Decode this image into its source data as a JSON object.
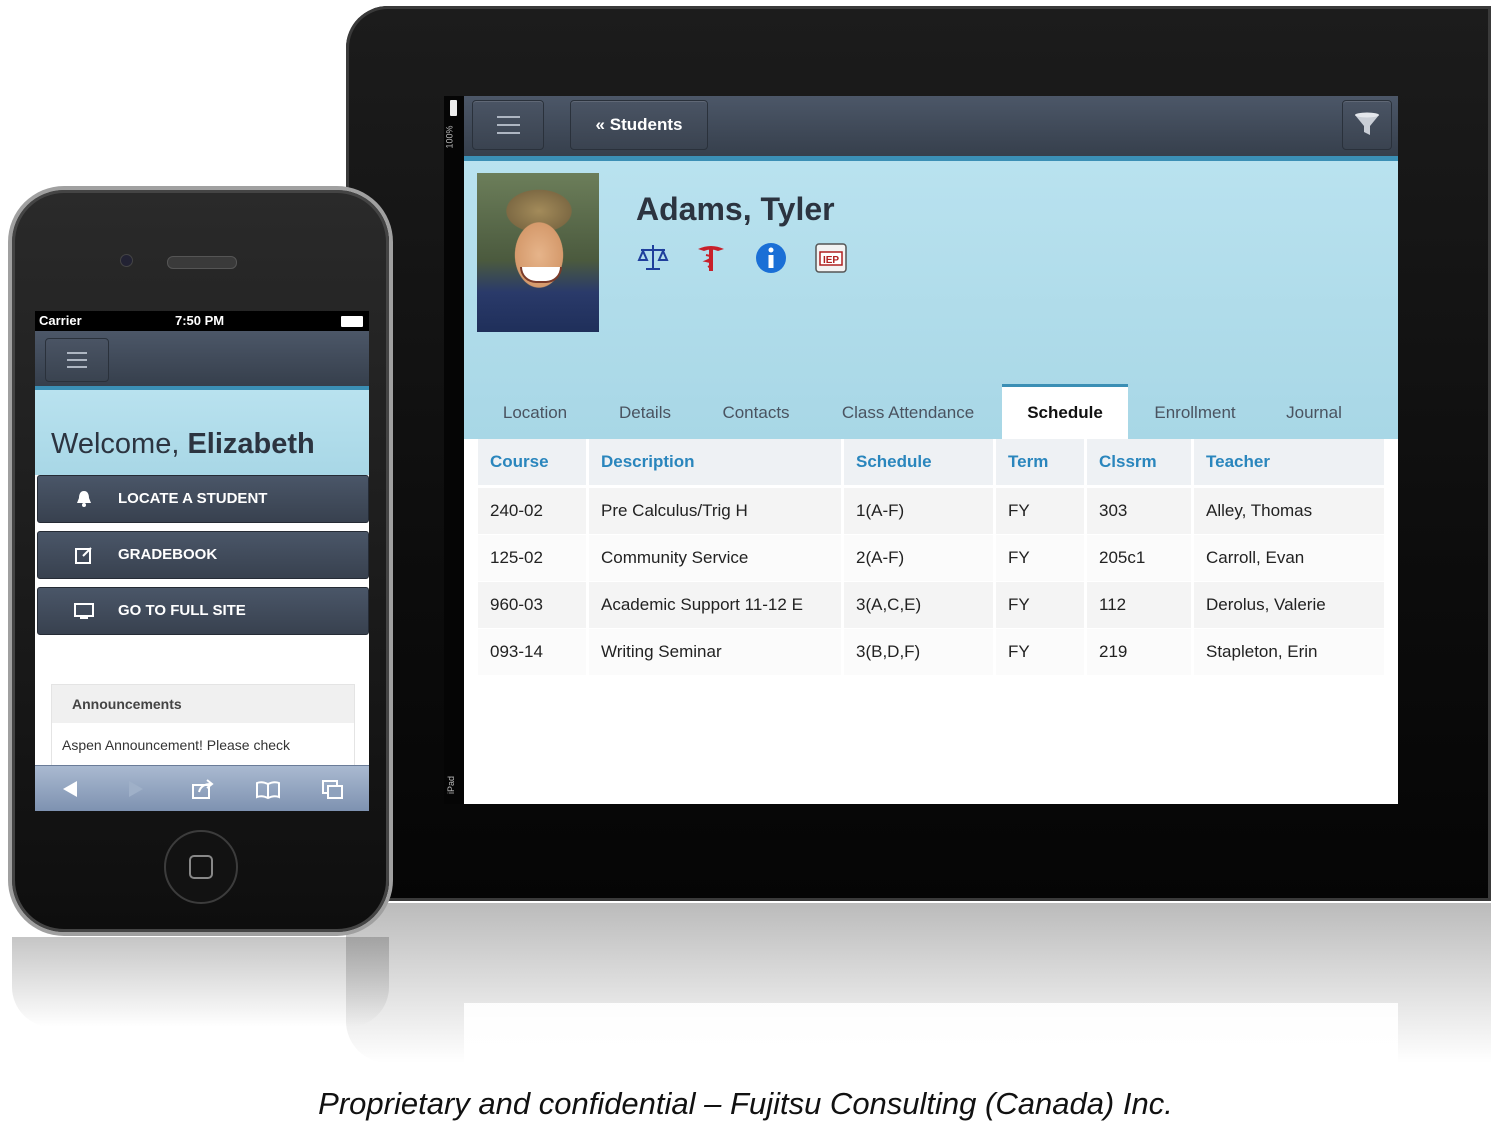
{
  "ipad": {
    "status": {
      "battery_pct": "100%",
      "device": "iPad"
    },
    "toolbar": {
      "back_label": "« Students"
    },
    "student": {
      "name": "Adams, Tyler",
      "iep_label": "IEP"
    },
    "tabs": [
      {
        "label": "Location"
      },
      {
        "label": "Details"
      },
      {
        "label": "Contacts"
      },
      {
        "label": "Class Attendance"
      },
      {
        "label": "Schedule"
      },
      {
        "label": "Enrollment"
      },
      {
        "label": "Journal"
      }
    ],
    "active_tab": "Schedule",
    "schedule": {
      "columns": [
        "Course",
        "Description",
        "Schedule",
        "Term",
        "Clssrm",
        "Teacher"
      ],
      "rows": [
        [
          "240-02",
          "Pre Calculus/Trig H",
          "1(A-F)",
          "FY",
          "303",
          "Alley, Thomas"
        ],
        [
          "125-02",
          "Community Service",
          "2(A-F)",
          "FY",
          "205c1",
          "Carroll, Evan"
        ],
        [
          "960-03",
          "Academic Support 11-12 E",
          "3(A,C,E)",
          "FY",
          "112",
          "Derolus, Valerie"
        ],
        [
          "093-14",
          "Writing Seminar",
          "3(B,D,F)",
          "FY",
          "219",
          "Stapleton, Erin"
        ]
      ]
    }
  },
  "iphone": {
    "status": {
      "carrier": "Carrier",
      "time": "7:50 PM"
    },
    "welcome_prefix": "Welcome,",
    "welcome_name": "Elizabeth",
    "buttons": [
      {
        "label": "LOCATE A STUDENT",
        "icon": "bell-icon"
      },
      {
        "label": "GRADEBOOK",
        "icon": "edit-icon"
      },
      {
        "label": "GO TO FULL SITE",
        "icon": "monitor-icon"
      }
    ],
    "announcements": {
      "title": "Announcements",
      "text": "Aspen Announcement! Please check"
    }
  },
  "caption": "Proprietary and confidential – Fujitsu Consulting (Canada) Inc.",
  "colors": {
    "accent": "#3b8fb5",
    "toolbar": "#3f4957",
    "header_text": "#2a86bd",
    "hero": "#b9e2ef"
  }
}
